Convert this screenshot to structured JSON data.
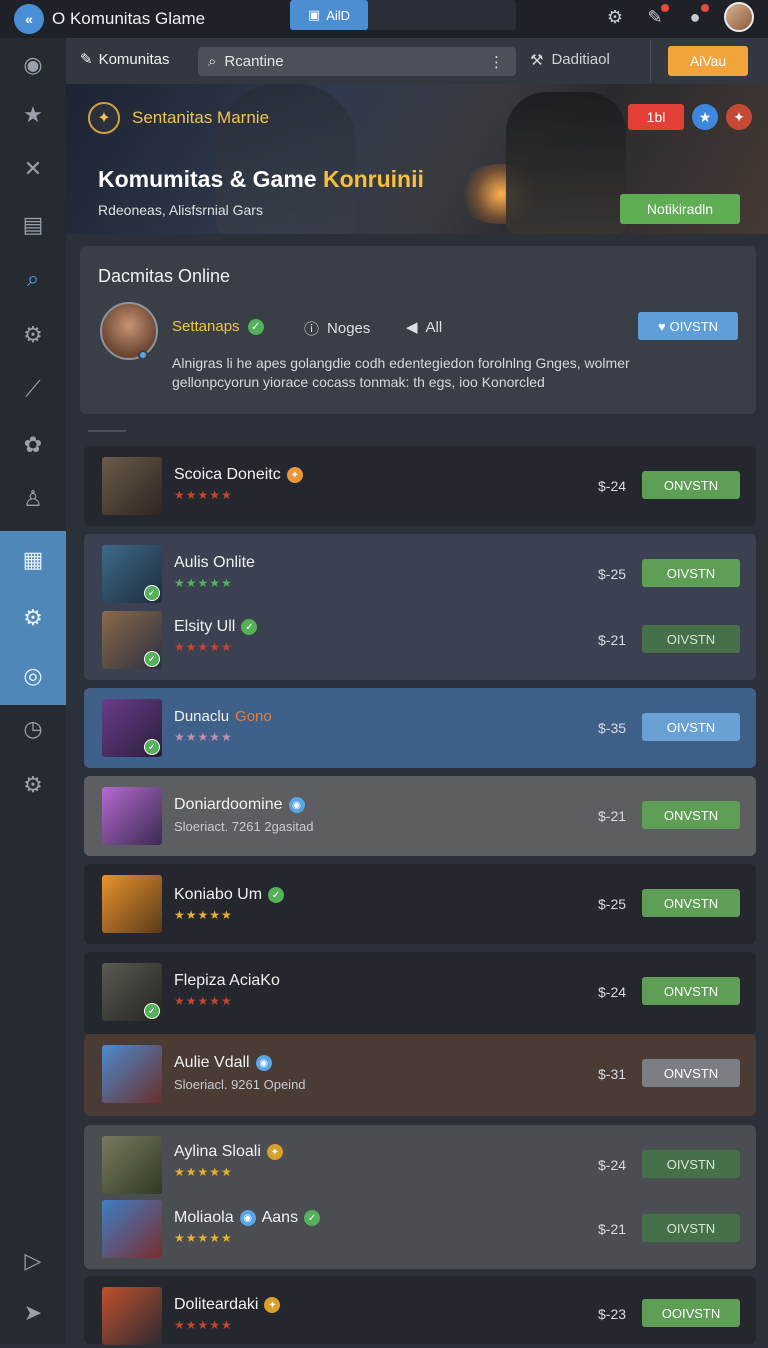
{
  "topbar": {
    "title": "O Komunitas Glame",
    "add_label": "AilD"
  },
  "subbar": {
    "tab_label": "Komunitas",
    "search_value": "Rcantine",
    "detail_label": "Daditiaol",
    "cta_label": "AiVau"
  },
  "banner": {
    "subtitle": "Sentanitas Marnie",
    "title_prefix": "Komumitas & Game ",
    "title_accent": "Konruinii",
    "caption": "Rdeoneas, Alisfsrnial Gars",
    "chip_label": "1bl",
    "button_label": "Notikiradln"
  },
  "info": {
    "title": "Dacmitas Online",
    "name": "Settanaps",
    "notes_label": "Noges",
    "all_label": "All",
    "button_label": "OIVSTN",
    "description": "Alnigras li he apes golangdie codh edentegiedon forolnlng Gnges, wolmer gellonpcyorun yiorace cocass tonmak: th egs, ioo Konorcled"
  },
  "games": [
    {
      "name": "Scoica Doneitc",
      "stars": "★★★★★",
      "price": "$-24",
      "button": "ONVSTN"
    },
    {
      "name": "Aulis Onlite",
      "stars": "★★★★★",
      "price": "$-25",
      "button": "OIVSTN"
    },
    {
      "name": "Elsity Ull",
      "stars": "★★★★★",
      "price": "$-21",
      "button": "OIVSTN"
    },
    {
      "name": "Dunaclu",
      "name_accent": "Gono",
      "stars": "★★★★★",
      "price": "$-35",
      "button": "OIVSTN"
    },
    {
      "name": "Doniardoomine",
      "subline": "Sloeriact. 7261 2gasitad",
      "price": "$-21",
      "button": "ONVSTN"
    },
    {
      "name": "Koniabo Um",
      "stars": "★★★★★",
      "price": "$-25",
      "button": "ONVSTN"
    },
    {
      "name": "Flepiza AciaKo",
      "stars": "★★★★★",
      "price": "$-24",
      "button": "ONVSTN"
    },
    {
      "name": "Aulie Vdall",
      "subline": "Sloeriacl. 9261 Opeind",
      "price": "$-31",
      "button": "ONVSTN"
    },
    {
      "name": "Aylina Sloali",
      "stars": "★★★★★",
      "price": "$-24",
      "button": "OIVSTN"
    },
    {
      "name": "Moliaola",
      "name_extra": "Aans",
      "stars": "★★★★★",
      "price": "$-21",
      "button": "OIVSTN"
    },
    {
      "name": "Doliteardaki",
      "stars": "★★★★★",
      "price": "$-23",
      "button": "OOIVSTN"
    }
  ],
  "icons": {
    "settings": "gear-icon",
    "edit": "edit-icon",
    "notification": "notification-icon",
    "sidebar": [
      "game-icon",
      "star-icon",
      "crossed-swords-icon",
      "document-icon",
      "search-icon",
      "settings-icon",
      "wrench-icon",
      "puzzle-icon",
      "user-icon",
      "grid-icon",
      "gear-icon",
      "timer-icon",
      "compass-icon",
      "settings-icon",
      "play-icon",
      "navigate-icon"
    ]
  },
  "colors": {
    "accent_blue": "#4c8fd1",
    "accent_orange": "#f0a43a",
    "accent_green": "#5fae54",
    "gold_text": "#f2c44b"
  }
}
